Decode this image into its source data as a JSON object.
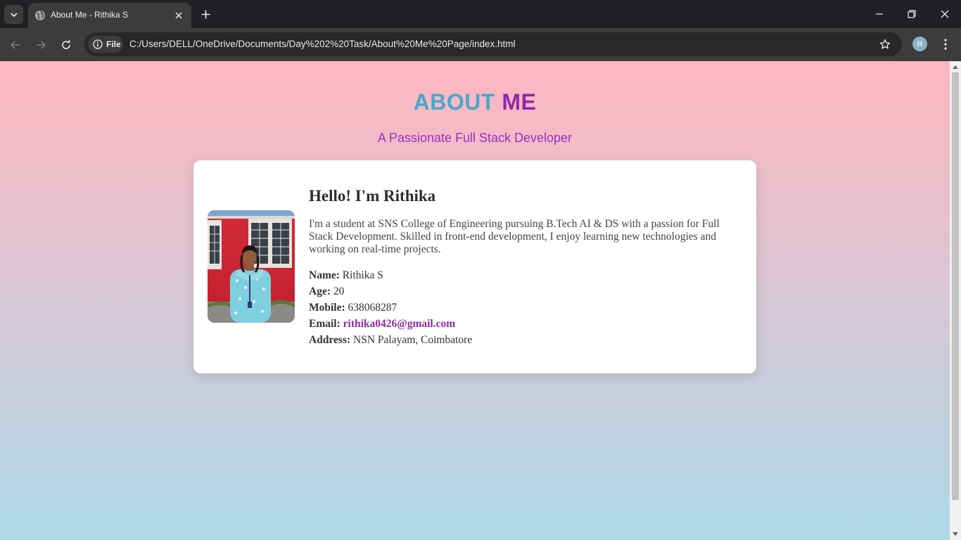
{
  "browser": {
    "tab_title": "About Me - Rithika S",
    "file_chip_label": "File",
    "url": "C:/Users/DELL/OneDrive/Documents/Day%202%20Task/About%20Me%20Page/index.html",
    "profile_initial": "R"
  },
  "page": {
    "heading_part1": "ABOUT",
    "heading_part2": "ME",
    "subheading": "A Passionate Full Stack Developer",
    "greeting": "Hello! I'm Rithika",
    "bio": "I'm a student at SNS College of Engineering pursuing B.Tech AI & DS with a passion for Full Stack Development. Skilled in front-end development, I enjoy learning new technologies and working on real-time projects.",
    "details": {
      "name_label": "Name:",
      "name_value": "Rithika S",
      "age_label": "Age:",
      "age_value": "20",
      "mobile_label": "Mobile:",
      "mobile_value": "638068287",
      "email_label": "Email:",
      "email_value": "rithika0426@gmail.com",
      "address_label": "Address:",
      "address_value": "NSN Palayam, Coimbatore"
    }
  },
  "colors": {
    "gradient_top": "#ffb6c1",
    "gradient_bottom": "#add8e6",
    "heading_blue": "#4aa8c8",
    "heading_purple": "#8e2aa8",
    "subheading": "#9b30c4"
  }
}
